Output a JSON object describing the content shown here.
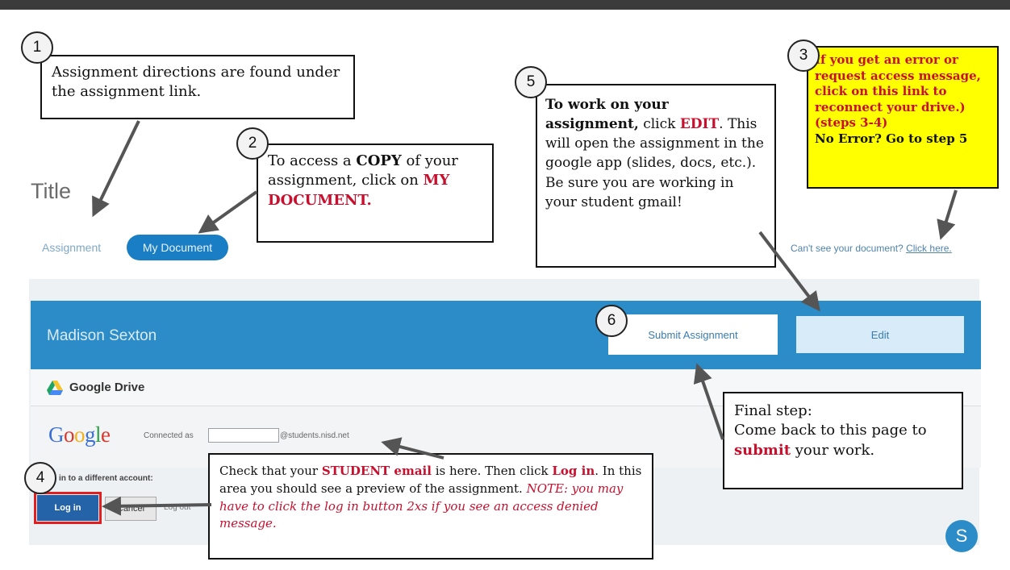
{
  "page": {
    "title": "Title",
    "tabs": {
      "assignment": "Assignment",
      "my_document": "My Document"
    },
    "cant_see_text": "Can't see your document?",
    "click_here": "Click here."
  },
  "assignment_panel": {
    "student_name": "Madison Sexton",
    "submit_label": "Submit Assignment",
    "edit_label": "Edit",
    "drive_label": "Google Drive",
    "google_logo": [
      "G",
      "o",
      "o",
      "g",
      "l",
      "e"
    ],
    "google_colors": [
      "#3b6fd1",
      "#d8372c",
      "#f2b21c",
      "#3b6fd1",
      "#2e9e48",
      "#d8372c"
    ],
    "connected_as": "Connected as",
    "email_domain": "@students.nisd.net",
    "signin_different": "gn in to a different account:",
    "login_label": "Log in",
    "cancel_label": "Cancel",
    "logout_label": "Log out",
    "avatar_letter": "S",
    "banner_color": "#2c8cc8",
    "drive_icon": "google-drive-icon"
  },
  "callouts": {
    "c1": {
      "step": "1",
      "text": "Assignment directions are found under the assignment link."
    },
    "c2": {
      "step": "2",
      "pre": "To access a ",
      "copy": "COPY",
      "mid": " of your assignment, click on ",
      "red": "MY DOCUMENT."
    },
    "c3": {
      "step": "3",
      "red": "If you get an error or request access message, click on this link to reconnect your drive.) (steps 3-4)",
      "black": "No Error? Go to step 5",
      "bg": "#ffff00"
    },
    "c4": {
      "step": "4",
      "t1": "Check that your ",
      "red1": "STUDENT email",
      "t2": " is here. Then click ",
      "red2": "Log in",
      "t3": ". In this area you should see a preview of the assignment. ",
      "note": "NOTE: you may have to click the log in button 2xs if you see an access denied message."
    },
    "c5": {
      "step": "5",
      "bold": "To work on your assignment,",
      "t1": " click ",
      "red": "EDIT",
      "t2": ". This will open the assignment in the google app (slides, docs, etc.). Be sure you are working in your student gmail!"
    },
    "c6": {
      "step": "6",
      "t1": "Final step:",
      "t2": "Come back to this page to ",
      "red": "submit",
      "t3": " your work."
    }
  }
}
